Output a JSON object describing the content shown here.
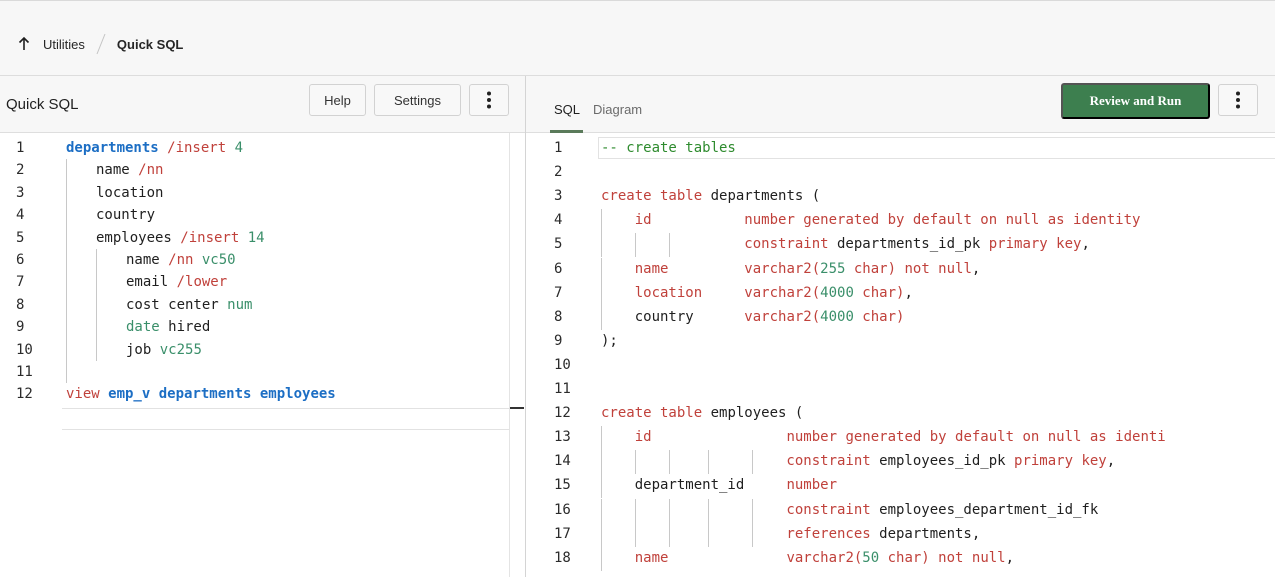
{
  "breadcrumb": {
    "parent": "Utilities",
    "current": "Quick SQL"
  },
  "left_panel": {
    "title": "Quick SQL",
    "help_label": "Help",
    "settings_label": "Settings",
    "lines": [
      {
        "n": "1",
        "indent": 0,
        "tokens": [
          {
            "t": "departments",
            "c": "kw-blue"
          },
          {
            "t": " /insert",
            "c": "kw-red"
          },
          {
            "t": " 4",
            "c": "num"
          }
        ]
      },
      {
        "n": "2",
        "indent": 1,
        "tokens": [
          {
            "t": "name",
            "c": "plain"
          },
          {
            "t": " /nn",
            "c": "kw-red"
          }
        ]
      },
      {
        "n": "3",
        "indent": 1,
        "tokens": [
          {
            "t": "location",
            "c": "plain"
          }
        ]
      },
      {
        "n": "4",
        "indent": 1,
        "tokens": [
          {
            "t": "country",
            "c": "plain"
          }
        ]
      },
      {
        "n": "5",
        "indent": 1,
        "tokens": [
          {
            "t": "employees",
            "c": "plain"
          },
          {
            "t": " /insert",
            "c": "kw-red"
          },
          {
            "t": " 14",
            "c": "num"
          }
        ]
      },
      {
        "n": "6",
        "indent": 2,
        "tokens": [
          {
            "t": "name",
            "c": "plain"
          },
          {
            "t": " /nn",
            "c": "kw-red"
          },
          {
            "t": " vc50",
            "c": "num"
          }
        ]
      },
      {
        "n": "7",
        "indent": 2,
        "tokens": [
          {
            "t": "email",
            "c": "plain"
          },
          {
            "t": " /lower",
            "c": "kw-red"
          }
        ]
      },
      {
        "n": "8",
        "indent": 2,
        "tokens": [
          {
            "t": "cost center",
            "c": "plain"
          },
          {
            "t": " num",
            "c": "num"
          }
        ]
      },
      {
        "n": "9",
        "indent": 2,
        "tokens": [
          {
            "t": "date",
            "c": "num"
          },
          {
            "t": " hired",
            "c": "plain"
          }
        ]
      },
      {
        "n": "10",
        "indent": 2,
        "tokens": [
          {
            "t": "job",
            "c": "plain"
          },
          {
            "t": " vc255",
            "c": "num"
          }
        ]
      },
      {
        "n": "11",
        "indent": 1,
        "tokens": []
      },
      {
        "n": "12",
        "indent": 0,
        "tokens": [
          {
            "t": "view",
            "c": "kw-red"
          },
          {
            "t": " emp_v",
            "c": "kw-blue"
          },
          {
            "t": " departments employees",
            "c": "kw-blue"
          }
        ]
      }
    ]
  },
  "right_panel": {
    "tab_sql": "SQL",
    "tab_diagram": "Diagram",
    "run_label": "Review and Run",
    "lines": [
      {
        "n": "1",
        "tokens": [
          {
            "t": "-- create tables",
            "c": "comment"
          }
        ]
      },
      {
        "n": "2",
        "tokens": []
      },
      {
        "n": "3",
        "tokens": [
          {
            "t": "create table",
            "c": "kw-red"
          },
          {
            "t": " departments (",
            "c": "plain"
          }
        ]
      },
      {
        "n": "4",
        "tokens": [
          {
            "t": "    id",
            "c": "kw-red"
          },
          {
            "t": "           number generated by default on null as identity",
            "c": "kw-red"
          }
        ]
      },
      {
        "n": "5",
        "tokens": [
          {
            "t": "                 constraint",
            "c": "kw-red"
          },
          {
            "t": " departments_id_pk ",
            "c": "plain"
          },
          {
            "t": "primary key",
            "c": "kw-red"
          },
          {
            "t": ",",
            "c": "plain"
          }
        ]
      },
      {
        "n": "6",
        "tokens": [
          {
            "t": "    name         ",
            "c": "kw-red"
          },
          {
            "t": "varchar2(",
            "c": "kw-red"
          },
          {
            "t": "255",
            "c": "num"
          },
          {
            "t": " char) ",
            "c": "kw-red"
          },
          {
            "t": "not null",
            "c": "kw-red"
          },
          {
            "t": ",",
            "c": "plain"
          }
        ]
      },
      {
        "n": "7",
        "tokens": [
          {
            "t": "    location     ",
            "c": "kw-red"
          },
          {
            "t": "varchar2(",
            "c": "kw-red"
          },
          {
            "t": "4000",
            "c": "num"
          },
          {
            "t": " char)",
            "c": "kw-red"
          },
          {
            "t": ",",
            "c": "plain"
          }
        ]
      },
      {
        "n": "8",
        "tokens": [
          {
            "t": "    country      ",
            "c": "plain"
          },
          {
            "t": "varchar2(",
            "c": "kw-red"
          },
          {
            "t": "4000",
            "c": "num"
          },
          {
            "t": " char)",
            "c": "kw-red"
          }
        ]
      },
      {
        "n": "9",
        "tokens": [
          {
            "t": ");",
            "c": "plain"
          }
        ]
      },
      {
        "n": "10",
        "tokens": []
      },
      {
        "n": "11",
        "tokens": []
      },
      {
        "n": "12",
        "tokens": [
          {
            "t": "create table",
            "c": "kw-red"
          },
          {
            "t": " employees (",
            "c": "plain"
          }
        ]
      },
      {
        "n": "13",
        "tokens": [
          {
            "t": "    id",
            "c": "kw-red"
          },
          {
            "t": "                number generated by default on null as identi",
            "c": "kw-red"
          }
        ]
      },
      {
        "n": "14",
        "tokens": [
          {
            "t": "                      constraint",
            "c": "kw-red"
          },
          {
            "t": " employees_id_pk ",
            "c": "plain"
          },
          {
            "t": "primary key",
            "c": "kw-red"
          },
          {
            "t": ",",
            "c": "plain"
          }
        ]
      },
      {
        "n": "15",
        "tokens": [
          {
            "t": "    department_id     ",
            "c": "plain"
          },
          {
            "t": "number",
            "c": "kw-red"
          }
        ]
      },
      {
        "n": "16",
        "tokens": [
          {
            "t": "                      constraint",
            "c": "kw-red"
          },
          {
            "t": " employees_department_id_fk",
            "c": "plain"
          }
        ]
      },
      {
        "n": "17",
        "tokens": [
          {
            "t": "                      references",
            "c": "kw-red"
          },
          {
            "t": " departments,",
            "c": "plain"
          }
        ]
      },
      {
        "n": "18",
        "tokens": [
          {
            "t": "    name              ",
            "c": "kw-red"
          },
          {
            "t": "varchar2(",
            "c": "kw-red"
          },
          {
            "t": "50",
            "c": "num"
          },
          {
            "t": " char) ",
            "c": "kw-red"
          },
          {
            "t": "not null",
            "c": "kw-red"
          },
          {
            "t": ",",
            "c": "plain"
          }
        ]
      }
    ]
  },
  "icons": {
    "up": "arrow-up-icon",
    "more": "kebab-menu-icon"
  }
}
